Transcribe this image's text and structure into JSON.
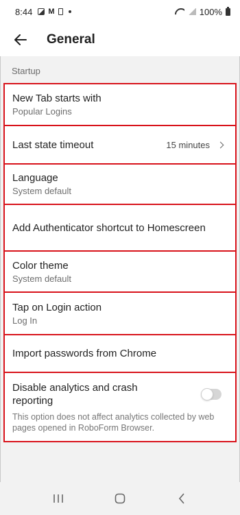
{
  "status_bar": {
    "time": "8:44",
    "icons": [
      "gallery-icon",
      "gmail-icon",
      "sim-icon",
      "notification-dot-icon",
      "wifi-icon",
      "signal-icon",
      "battery-icon"
    ],
    "battery": "100%"
  },
  "app_bar": {
    "back_icon": "arrow-left-icon",
    "title": "General"
  },
  "section": {
    "header": "Startup"
  },
  "settings": [
    {
      "title": "New Tab starts with",
      "subtitle": "Popular Logins"
    },
    {
      "title": "Last state timeout",
      "value": "15 minutes",
      "icon": "chevron-right-icon"
    },
    {
      "title": "Language",
      "subtitle": "System default"
    },
    {
      "title": "Add Authenticator shortcut to Homescreen"
    },
    {
      "title": "Color theme",
      "subtitle": "System default"
    },
    {
      "title": "Tap on Login action",
      "subtitle": "Log In"
    },
    {
      "title": "Import passwords from Chrome"
    },
    {
      "title": "Disable analytics and crash reporting",
      "description": "This option does not affect analytics collected by web pages opened in RoboForm Browser.",
      "toggle_on": false
    }
  ],
  "nav_bar": {
    "icons": [
      "recent-apps-icon",
      "home-icon",
      "back-nav-icon"
    ]
  },
  "colors": {
    "highlight_border": "#d8121a",
    "background": "#f2f2f2",
    "surface": "#ffffff"
  }
}
